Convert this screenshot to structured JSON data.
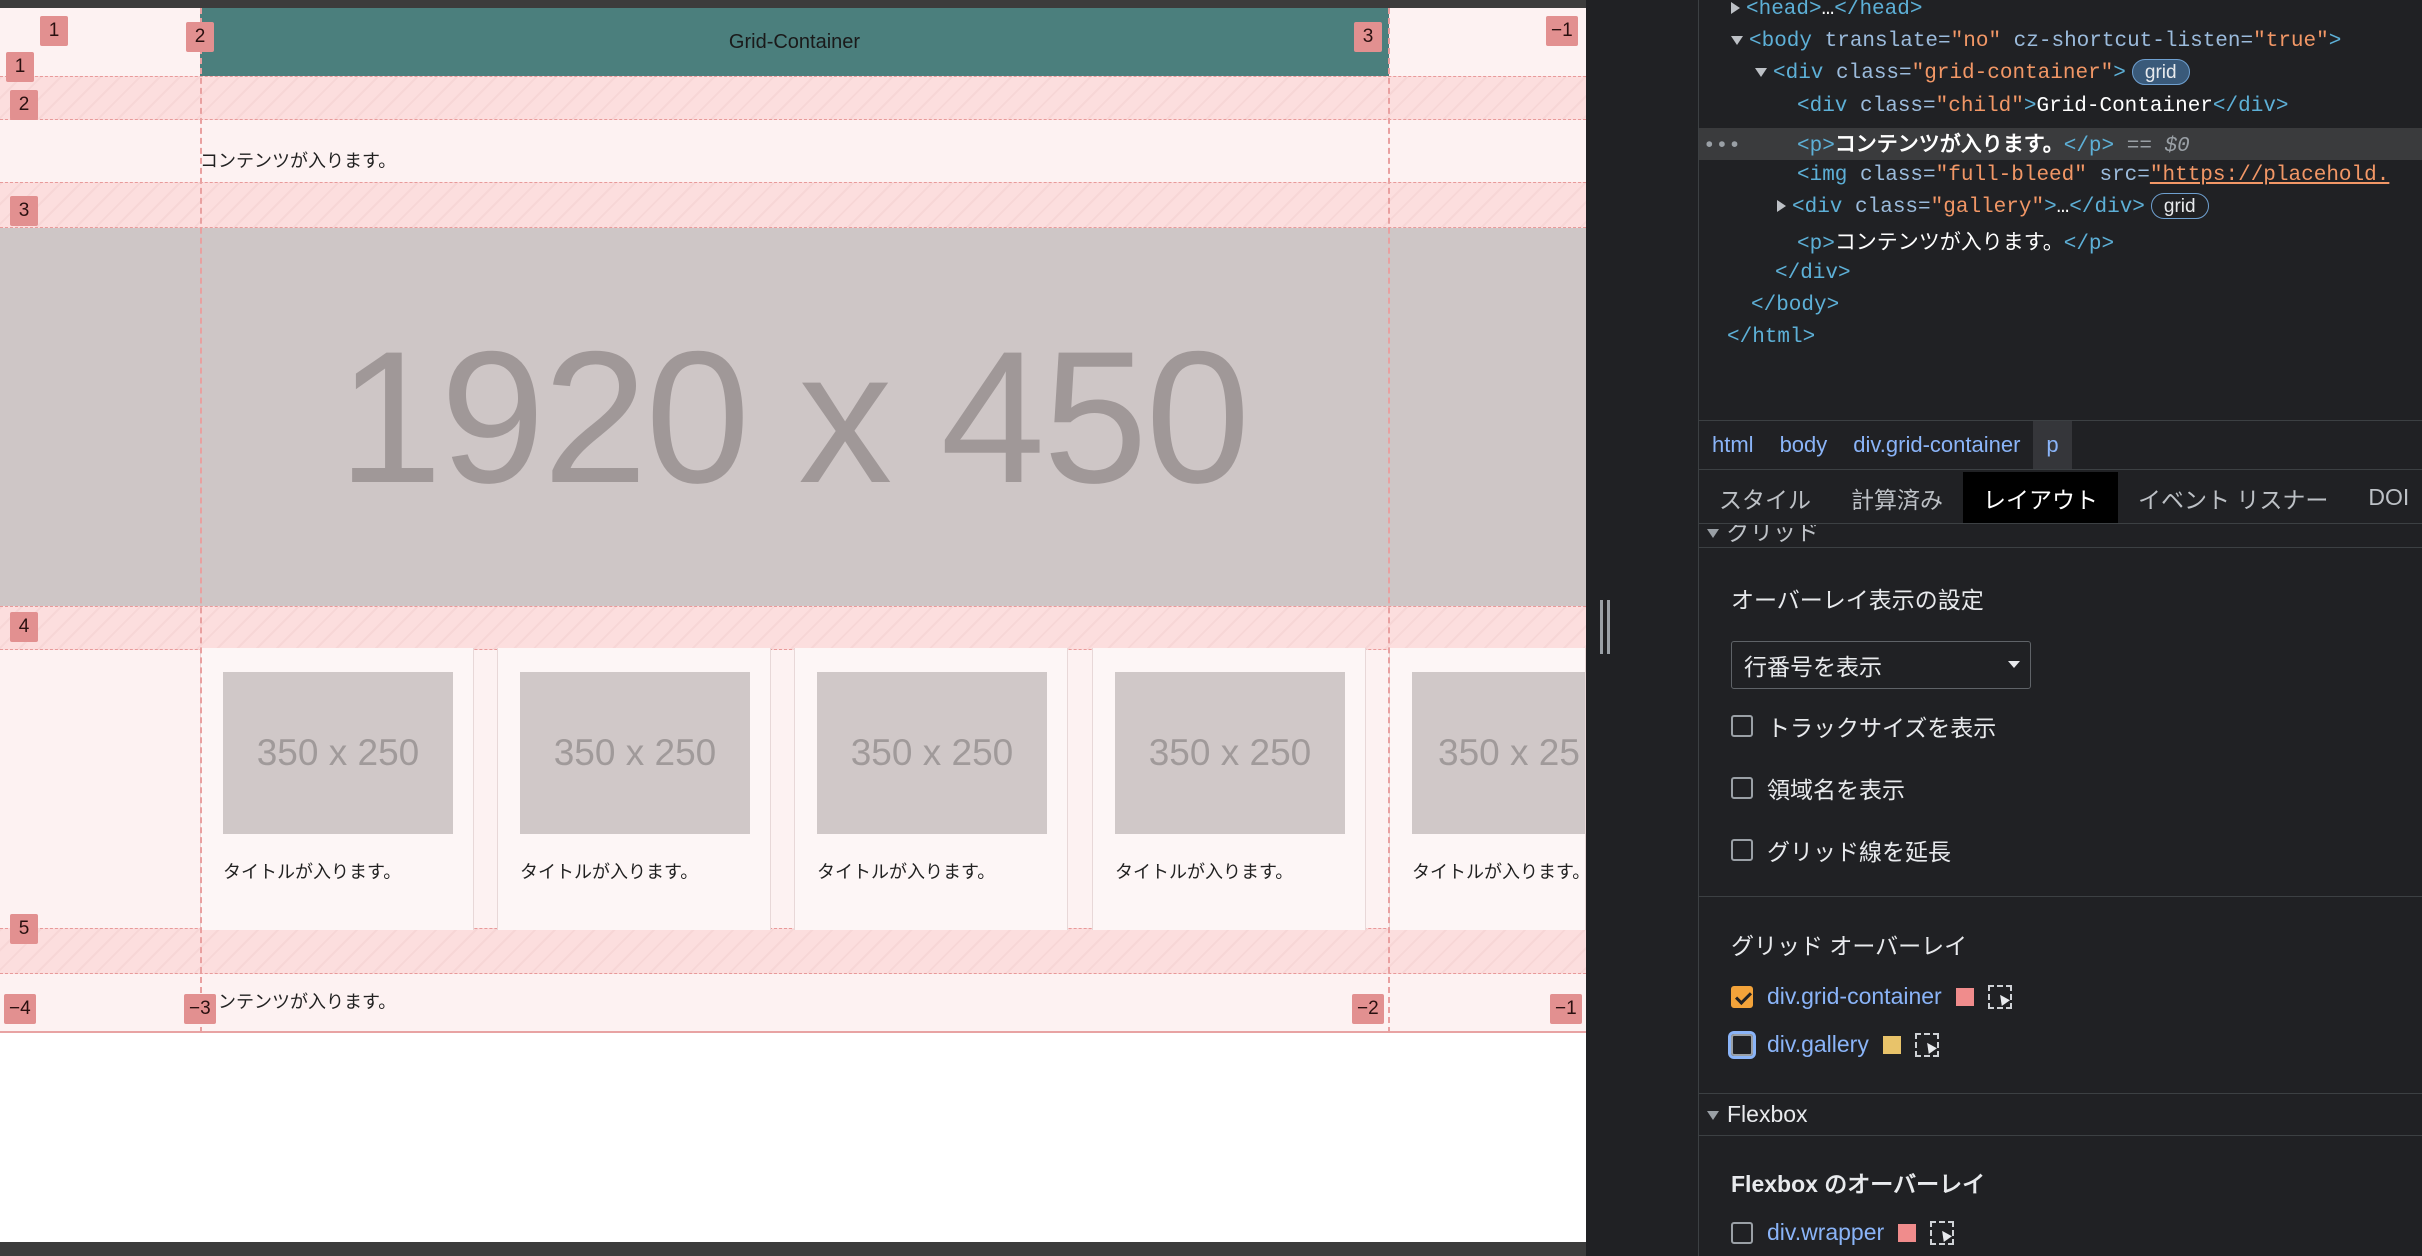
{
  "viewport": {
    "header_text": "Grid-Container",
    "content_text_1": "コンテンツが入ります。",
    "content_text_2": "ンテンツが入ります。",
    "hero_text": "1920 x 450",
    "cards": [
      {
        "img": "350 x 250",
        "title": "タイトルが入ります。"
      },
      {
        "img": "350 x 250",
        "title": "タイトルが入ります。"
      },
      {
        "img": "350 x 250",
        "title": "タイトルが入ります。"
      },
      {
        "img": "350 x 250",
        "title": "タイトルが入ります。"
      },
      {
        "img": "350 x 25",
        "title": "タイトルが入ります。"
      }
    ],
    "col_badges_top": [
      "1",
      "2",
      "3",
      "−1"
    ],
    "row_badges": [
      "1",
      "2",
      "3",
      "4",
      "5"
    ],
    "col_badges_bottom": [
      "−4",
      "−3",
      "−2",
      "−1"
    ]
  },
  "elements_tree": {
    "line_head": {
      "open": "<head>",
      "ellipsis": "…",
      "close": "</head>"
    },
    "line_body": {
      "open": "<body",
      "attr1": " translate=",
      "val1": "\"no\"",
      "attr2": " cz-shortcut-listen=",
      "val2": "\"true\"",
      "close": ">"
    },
    "line_div": {
      "open": "<div",
      "attr": " class=",
      "val": "\"grid-container\"",
      "close": ">",
      "badge": "grid"
    },
    "line_child": {
      "open": "<div",
      "attr": " class=",
      "val": "\"child\"",
      "close": ">",
      "text": "Grid-Container",
      "end": "</div>"
    },
    "line_p": {
      "dots": "•••",
      "open": "<p>",
      "text": "コンテンツが入ります。",
      "close": "</p>",
      "eq": " == $0"
    },
    "line_img": {
      "open": "<img",
      "attr1": " class=",
      "val1": "\"full-bleed\"",
      "attr2": " src=",
      "val2": "\"https://placehold."
    },
    "line_gallery": {
      "open": "<div",
      "attr": " class=",
      "val": "\"gallery\"",
      "close": ">",
      "ellipsis": "…",
      "end": "</div>",
      "badge": "grid"
    },
    "line_p2": {
      "open": "<p>",
      "text": "コンテンツが入ります。",
      "close": "</p>"
    },
    "line_div_end": "</div>",
    "line_body_end": "</body>",
    "line_html_end": "</html>"
  },
  "breadcrumb": [
    "html",
    "body",
    "div.grid-container",
    "p"
  ],
  "tabs": [
    "スタイル",
    "計算済み",
    "レイアウト",
    "イベント リスナー",
    "DOI"
  ],
  "active_tab": "レイアウト",
  "layout": {
    "grid_section": "グリッド",
    "overlay_settings": "オーバーレイ表示の設定",
    "dropdown_value": "行番号を表示",
    "checkboxes": [
      {
        "label": "トラックサイズを表示",
        "checked": false
      },
      {
        "label": "領域名を表示",
        "checked": false
      },
      {
        "label": "グリッド線を延長",
        "checked": false
      }
    ],
    "grid_overlay_title": "グリッド オーバーレイ",
    "overlays": [
      {
        "label": "div.grid-container",
        "checked": true,
        "color": "#f08c8c"
      },
      {
        "label": "div.gallery",
        "checked": false,
        "color": "#e8c36a"
      }
    ],
    "flexbox_section": "Flexbox",
    "flexbox_overlay_title": "Flexbox のオーバーレイ",
    "flex_overlays": [
      {
        "label": "div.wrapper",
        "checked": false,
        "color": "#f08c8c"
      }
    ]
  }
}
